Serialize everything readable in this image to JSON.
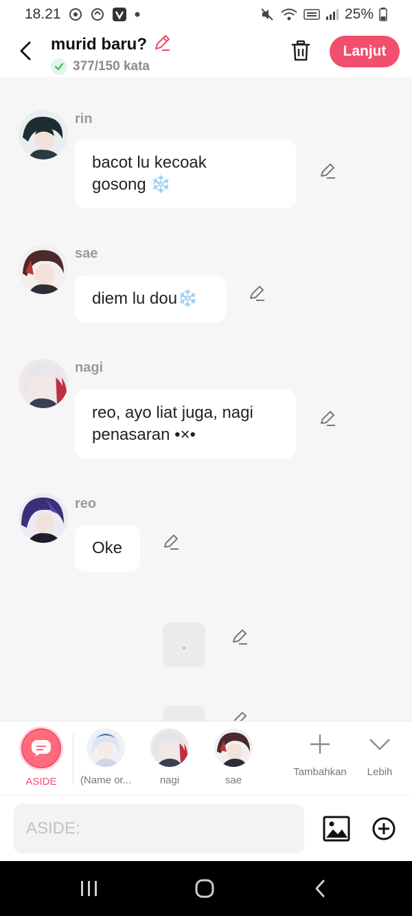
{
  "status_bar": {
    "time": "18.21",
    "battery": "25%"
  },
  "header": {
    "title": "murid baru?",
    "word_count": "377/150 kata",
    "next_label": "Lanjut"
  },
  "messages": [
    {
      "sender": "rin",
      "text_line1": "bacot lu kecoak",
      "text_line2": "gosong",
      "emoji": "❄️"
    },
    {
      "sender": "sae",
      "text_line1": "diem lu dou",
      "emoji": "❄️"
    },
    {
      "sender": "nagi",
      "text_line1": "reo, ayo liat juga, nagi",
      "text_line2": "penasaran •×•"
    },
    {
      "sender": "reo",
      "text_line1": "Oke"
    }
  ],
  "aside_messages": [
    {
      "text": "."
    }
  ],
  "characters": [
    {
      "label": "ASIDE"
    },
    {
      "label": "(Name or..."
    },
    {
      "label": "nagi"
    },
    {
      "label": "sae"
    }
  ],
  "tools": {
    "add_label": "Tambahkan",
    "more_label": "Lebih"
  },
  "input": {
    "placeholder": "ASIDE:"
  },
  "colors": {
    "accent": "#f24e6e",
    "bubble": "#ffffff",
    "background": "#f6f6f6"
  }
}
